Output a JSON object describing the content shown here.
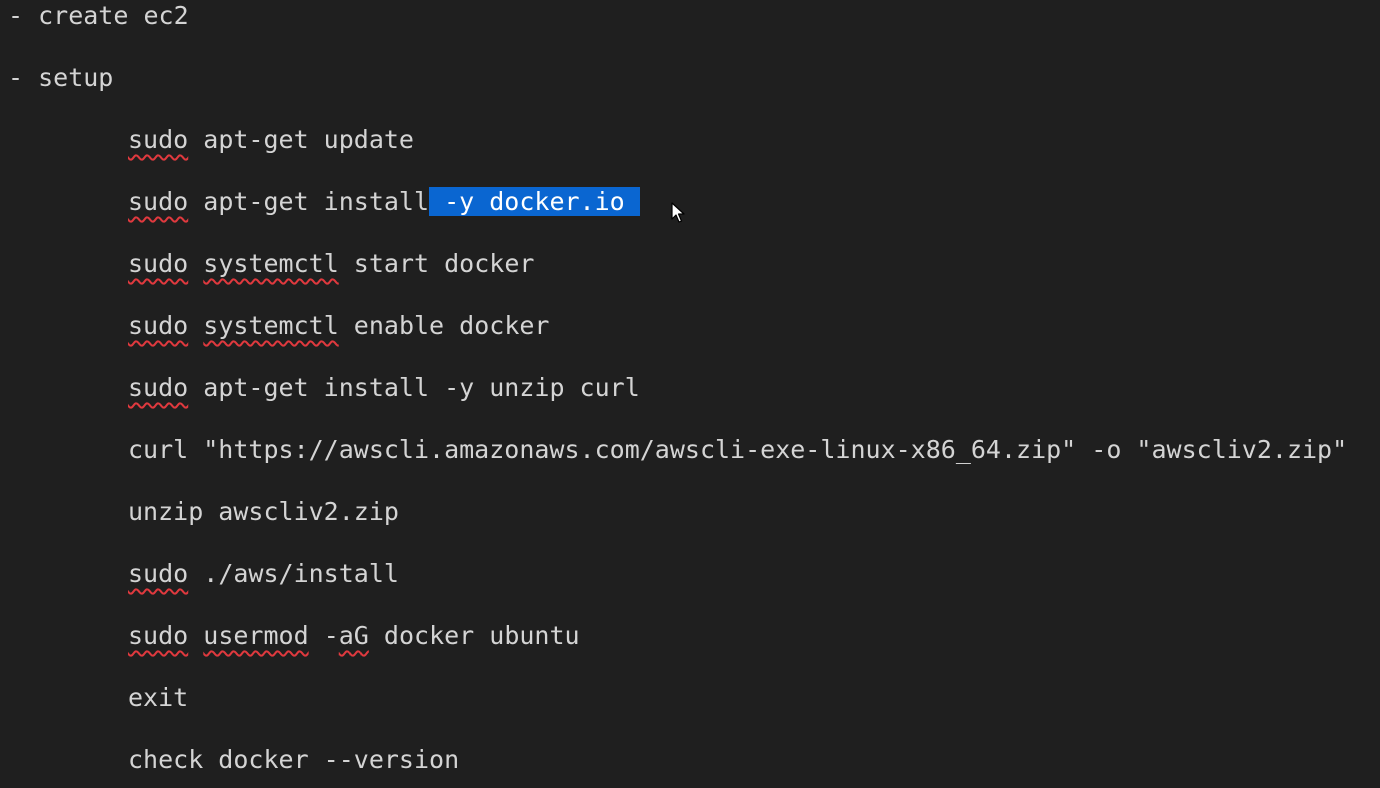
{
  "lines": {
    "create_ec2": "- create ec2",
    "setup": "- setup",
    "update": {
      "cmd": "sudo",
      "rest": " apt-get update"
    },
    "install_docker": {
      "cmd": "sudo",
      "pre": " apt-get install",
      "selected": " -y docker.io "
    },
    "start_docker": {
      "cmd": "sudo",
      "sp": " ",
      "tool": "systemctl",
      "rest": " start docker"
    },
    "enable_docker": {
      "cmd": "sudo",
      "sp": " ",
      "tool": "systemctl",
      "rest": " enable docker"
    },
    "install_unzip": {
      "cmd": "sudo",
      "rest": " apt-get install -y unzip curl"
    },
    "curl_awscli": "curl \"https://awscli.amazonaws.com/awscli-exe-linux-x86_64.zip\" -o \"awscliv2.zip\"",
    "unzip_awscli": "unzip awscliv2.zip",
    "aws_install": {
      "cmd": "sudo",
      "rest": " ./aws/install"
    },
    "usermod": {
      "cmd": "sudo",
      "sp": " ",
      "tool": "usermod",
      "sp2": " -",
      "flag": "aG",
      "rest": " docker ubuntu"
    },
    "exit": "exit",
    "check_version": "check docker --version"
  },
  "icons": {
    "cursor": "mouse-pointer-icon"
  }
}
